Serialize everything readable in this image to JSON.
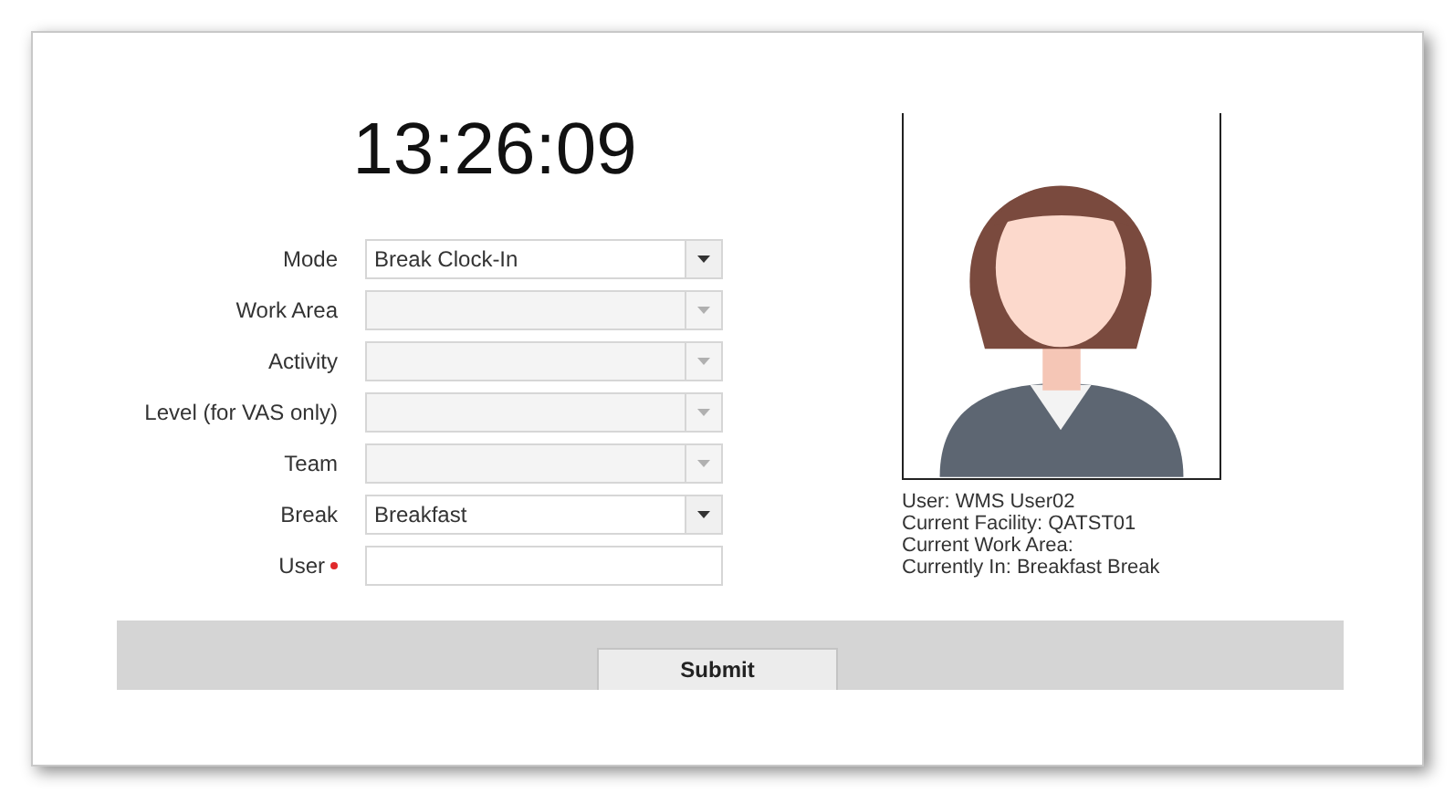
{
  "clock": "13:26:09",
  "fields": [
    {
      "label": "Mode",
      "kind": "select",
      "value": "Break Clock-In",
      "disabled": false,
      "required": false
    },
    {
      "label": "Work Area",
      "kind": "select",
      "disabled": true,
      "required": false
    },
    {
      "label": "Activity",
      "kind": "select",
      "disabled": true,
      "required": false
    },
    {
      "label": "Level (for VAS only)",
      "kind": "select",
      "disabled": true,
      "required": false
    },
    {
      "label": "Team",
      "kind": "select",
      "disabled": true,
      "required": false
    },
    {
      "label": "Break",
      "kind": "select",
      "value": "Breakfast",
      "disabled": false,
      "required": false
    },
    {
      "label": "User",
      "kind": "text",
      "disabled": false,
      "required": true
    }
  ],
  "info": [
    "User: WMS User02",
    "Current Facility: QATST01",
    "Current Work Area:",
    "Currently In: Breakfast Break"
  ],
  "submit": "Submit"
}
